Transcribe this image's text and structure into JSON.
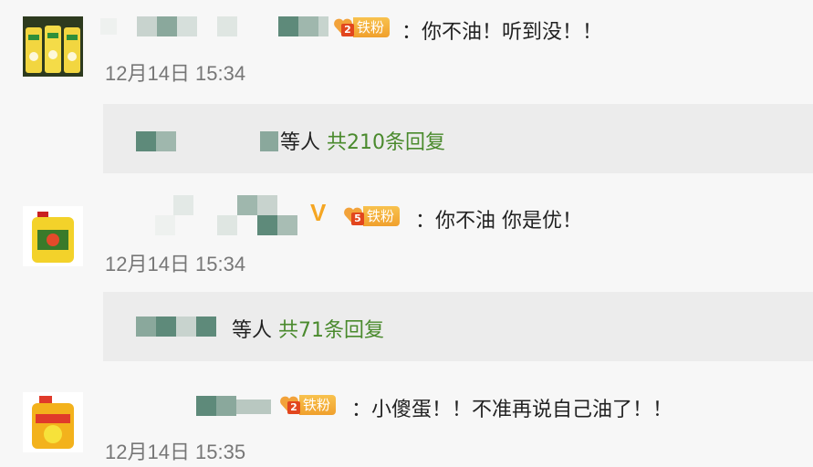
{
  "comments": [
    {
      "fan_badge_label": "铁粉",
      "fan_badge_level": "2",
      "text": "：你不油！听到没！！",
      "time": "12月14日 15:34",
      "reply_label": "等人",
      "reply_count": "共210条回复"
    },
    {
      "verified": "V",
      "fan_badge_label": "铁粉",
      "fan_badge_level": "5",
      "text": "：你不油  你是优！",
      "time": "12月14日 15:34",
      "reply_label": "等人",
      "reply_count": "共71条回复"
    },
    {
      "fan_badge_label": "铁粉",
      "fan_badge_level": "2",
      "text": "：小傻蛋！！不准再说自己油了！！",
      "time": "12月14日 15:35"
    }
  ],
  "colors": {
    "reply_link": "#4a8a2d",
    "badge": "#f0a02d",
    "mosaic_dark": "#5e8a7a",
    "mosaic_light": "#d9e3de"
  },
  "icons": [
    "dish-soap-avatar",
    "heart-fan-icon",
    "verified-v-icon"
  ]
}
